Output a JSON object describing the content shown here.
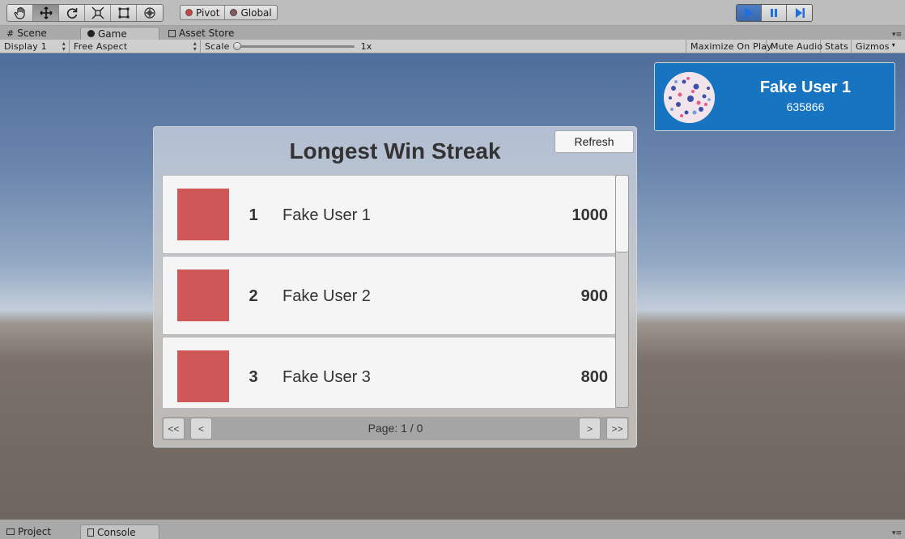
{
  "toolbar": {
    "tools": [
      {
        "icon": "hand-icon"
      },
      {
        "icon": "move-icon"
      },
      {
        "icon": "rotate-icon"
      },
      {
        "icon": "scale-icon"
      },
      {
        "icon": "rect-icon"
      },
      {
        "icon": "transform-icon"
      }
    ],
    "pivot_label": "Pivot",
    "global_label": "Global",
    "play_icon": "play-icon",
    "pause_icon": "pause-icon",
    "step_icon": "step-icon"
  },
  "tabs": {
    "scene": "Scene",
    "game": "Game",
    "asset_store": "Asset Store"
  },
  "gamebar": {
    "display": "Display 1",
    "aspect": "Free Aspect",
    "scale_label": "Scale",
    "scale_value": "1x",
    "maximize": "Maximize On Play",
    "mute": "Mute Audio",
    "stats": "Stats",
    "gizmos": "Gizmos"
  },
  "user": {
    "name": "Fake User 1",
    "score": "635866"
  },
  "leaderboard": {
    "title": "Longest Win Streak",
    "refresh": "Refresh",
    "rows": [
      {
        "rank": "1",
        "name": "Fake User 1",
        "score": "1000"
      },
      {
        "rank": "2",
        "name": "Fake User 2",
        "score": "900"
      },
      {
        "rank": "3",
        "name": "Fake User 3",
        "score": "800"
      }
    ],
    "pager": {
      "first": "<<",
      "prev": "<",
      "next": ">",
      "last": ">>",
      "page": "Page: 1 / 0"
    }
  },
  "bottom_tabs": {
    "project": "Project",
    "console": "Console"
  },
  "colors": {
    "user_panel": "#1774c0",
    "row_thumb": "#cf5758",
    "play_active": "#4e7ec3"
  }
}
